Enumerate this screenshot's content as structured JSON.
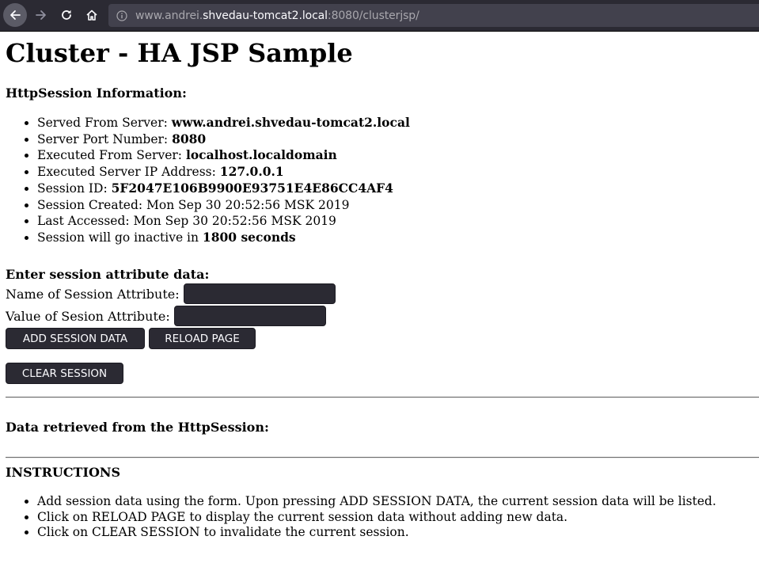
{
  "browser": {
    "url_prefix": "www.andrei.",
    "url_host": "shvedau-tomcat2.local",
    "url_suffix": ":8080/clusterjsp/"
  },
  "page": {
    "title": "Cluster - HA JSP Sample",
    "session_info_heading": "HttpSession Information:",
    "session_info": [
      {
        "label": "Served From Server: ",
        "value": "www.andrei.shvedau-tomcat2.local"
      },
      {
        "label": "Server Port Number: ",
        "value": "8080"
      },
      {
        "label": "Executed From Server: ",
        "value": "localhost.localdomain"
      },
      {
        "label": "Executed Server IP Address: ",
        "value": "127.0.0.1"
      },
      {
        "label": "Session ID: ",
        "value": "5F2047E106B9900E93751E4E86CC4AF4"
      },
      {
        "label": "Session Created: Mon Sep 30 20:52:56 MSK 2019",
        "value": ""
      },
      {
        "label": "Last Accessed: Mon Sep 30 20:52:56 MSK 2019",
        "value": ""
      },
      {
        "label": "Session will go inactive in ",
        "value": "1800 seconds"
      }
    ],
    "form": {
      "heading": "Enter session attribute data:",
      "name_label": "Name of Session Attribute:",
      "name_value": "",
      "value_label": "Value of Sesion Attribute:",
      "value_value": "",
      "add_button": "ADD SESSION DATA",
      "reload_button": "RELOAD PAGE",
      "clear_button": "CLEAR SESSION"
    },
    "retrieved_heading": "Data retrieved from the HttpSession:",
    "instructions_heading": "INSTRUCTIONS",
    "instructions": [
      "Add session data using the form. Upon pressing ADD SESSION DATA, the current session data will be listed.",
      "Click on RELOAD PAGE to display the current session data without adding new data.",
      "Click on CLEAR SESSION to invalidate the current session."
    ]
  }
}
